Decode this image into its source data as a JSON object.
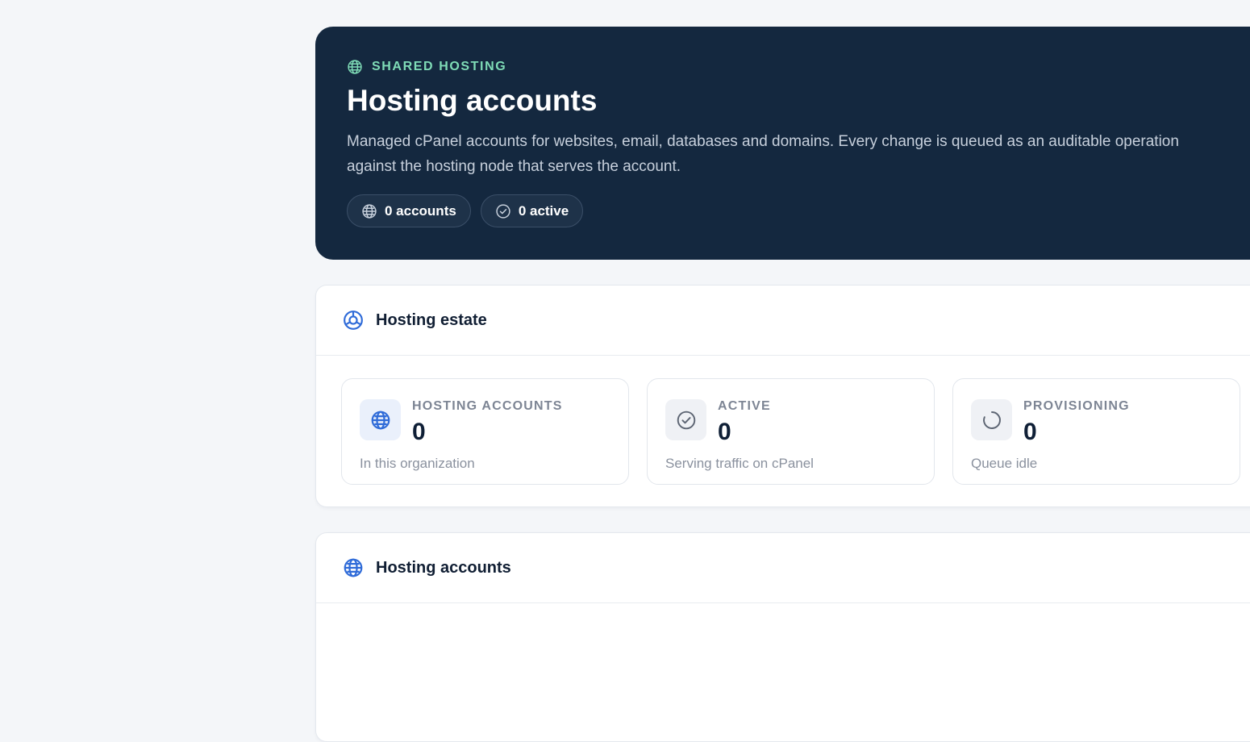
{
  "hero": {
    "eyebrow": "SHARED HOSTING",
    "title": "Hosting accounts",
    "description": "Managed cPanel accounts for websites, email, databases and domains. Every change is queued as an auditable operation",
    "description_line2": "against the hosting node that serves the account.",
    "pills": [
      {
        "icon": "www-globe-icon",
        "label": "0 accounts"
      },
      {
        "icon": "check-circle-icon",
        "label": "0 active"
      }
    ]
  },
  "estate": {
    "title": "Hosting estate",
    "icon": "target-icon",
    "stats": [
      {
        "icon": "www-globe-icon",
        "label": "HOSTING ACCOUNTS",
        "value": "0",
        "sub": "In this organization"
      },
      {
        "icon": "check-circle-icon",
        "label": "ACTIVE",
        "value": "0",
        "sub": "Serving traffic on cPanel"
      },
      {
        "icon": "spinner-icon",
        "label": "PROVISIONING",
        "value": "0",
        "sub": "Queue idle"
      }
    ]
  },
  "accounts": {
    "title": "Hosting accounts",
    "icon": "www-globe-icon"
  },
  "colors": {
    "hero_bg": "#14283f",
    "eyebrow": "#7fdcb7",
    "accent_blue": "#2f6bd8",
    "page_bg": "#f4f6f9"
  }
}
